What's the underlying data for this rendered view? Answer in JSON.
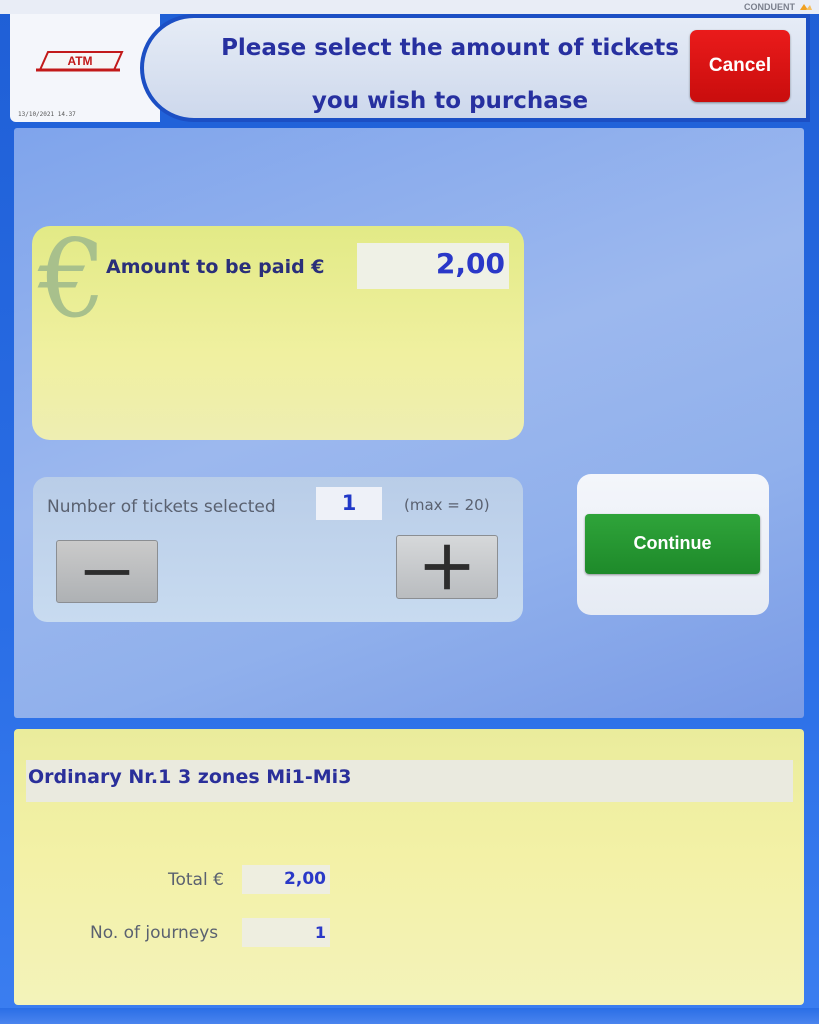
{
  "brand": {
    "label": "CONDUENT",
    "icon": "conduent-logo-icon"
  },
  "header": {
    "logo_text": "ATM",
    "datetime": "13/10/2021 14.37",
    "title_line1": "Please select the amount of tickets",
    "title_line2": "you wish to purchase",
    "cancel_label": "Cancel"
  },
  "amount": {
    "icon": "euro-icon",
    "label": "Amount to be paid €",
    "value": "2,00"
  },
  "tickets": {
    "label": "Number of tickets selected",
    "count": "1",
    "max": "(max = 20)",
    "minus_icon": "minus-icon",
    "plus_icon": "plus-icon"
  },
  "continue_label": "Continue",
  "ticket_info": {
    "title": "Ordinary Nr.1 3 zones Mi1-Mi3",
    "total_label": "Total €",
    "total_value": "2,00",
    "journeys_label": "No. of journeys",
    "journeys_value": "1"
  },
  "colors": {
    "cancel": "#d81414",
    "continue": "#22922e",
    "title_text": "#2730a0",
    "value_text": "#2a38c8"
  }
}
